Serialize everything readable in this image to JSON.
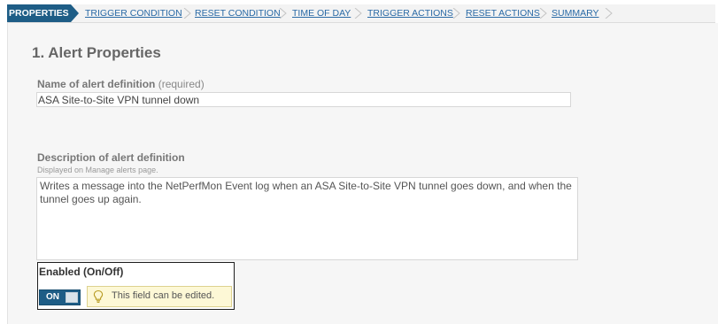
{
  "wizard": {
    "steps": [
      {
        "label": "PROPERTIES",
        "active": true
      },
      {
        "label": "TRIGGER CONDITION",
        "active": false
      },
      {
        "label": "RESET CONDITION",
        "active": false
      },
      {
        "label": "TIME OF DAY",
        "active": false
      },
      {
        "label": "TRIGGER ACTIONS",
        "active": false
      },
      {
        "label": "RESET ACTIONS",
        "active": false
      },
      {
        "label": "SUMMARY",
        "active": false
      }
    ]
  },
  "form": {
    "section_title": "1. Alert Properties",
    "name": {
      "label": "Name of alert definition",
      "required_note": "(required)",
      "value": "ASA Site-to-Site VPN tunnel down"
    },
    "description": {
      "label": "Description of alert definition",
      "helper": "Displayed on Manage alerts page.",
      "value": "Writes a message into the NetPerfMon Event log when an ASA Site-to-Site VPN tunnel goes down, and when the tunnel goes up again."
    },
    "enabled": {
      "label": "Enabled (On/Off)",
      "toggle_label": "ON",
      "state": true,
      "tooltip": "This field can be edited.",
      "tooltip_icon": "lightbulb-icon"
    }
  },
  "colors": {
    "accent": "#1e5d86",
    "link": "#2a6aa6",
    "tooltip_bg": "#fdf8d6"
  }
}
